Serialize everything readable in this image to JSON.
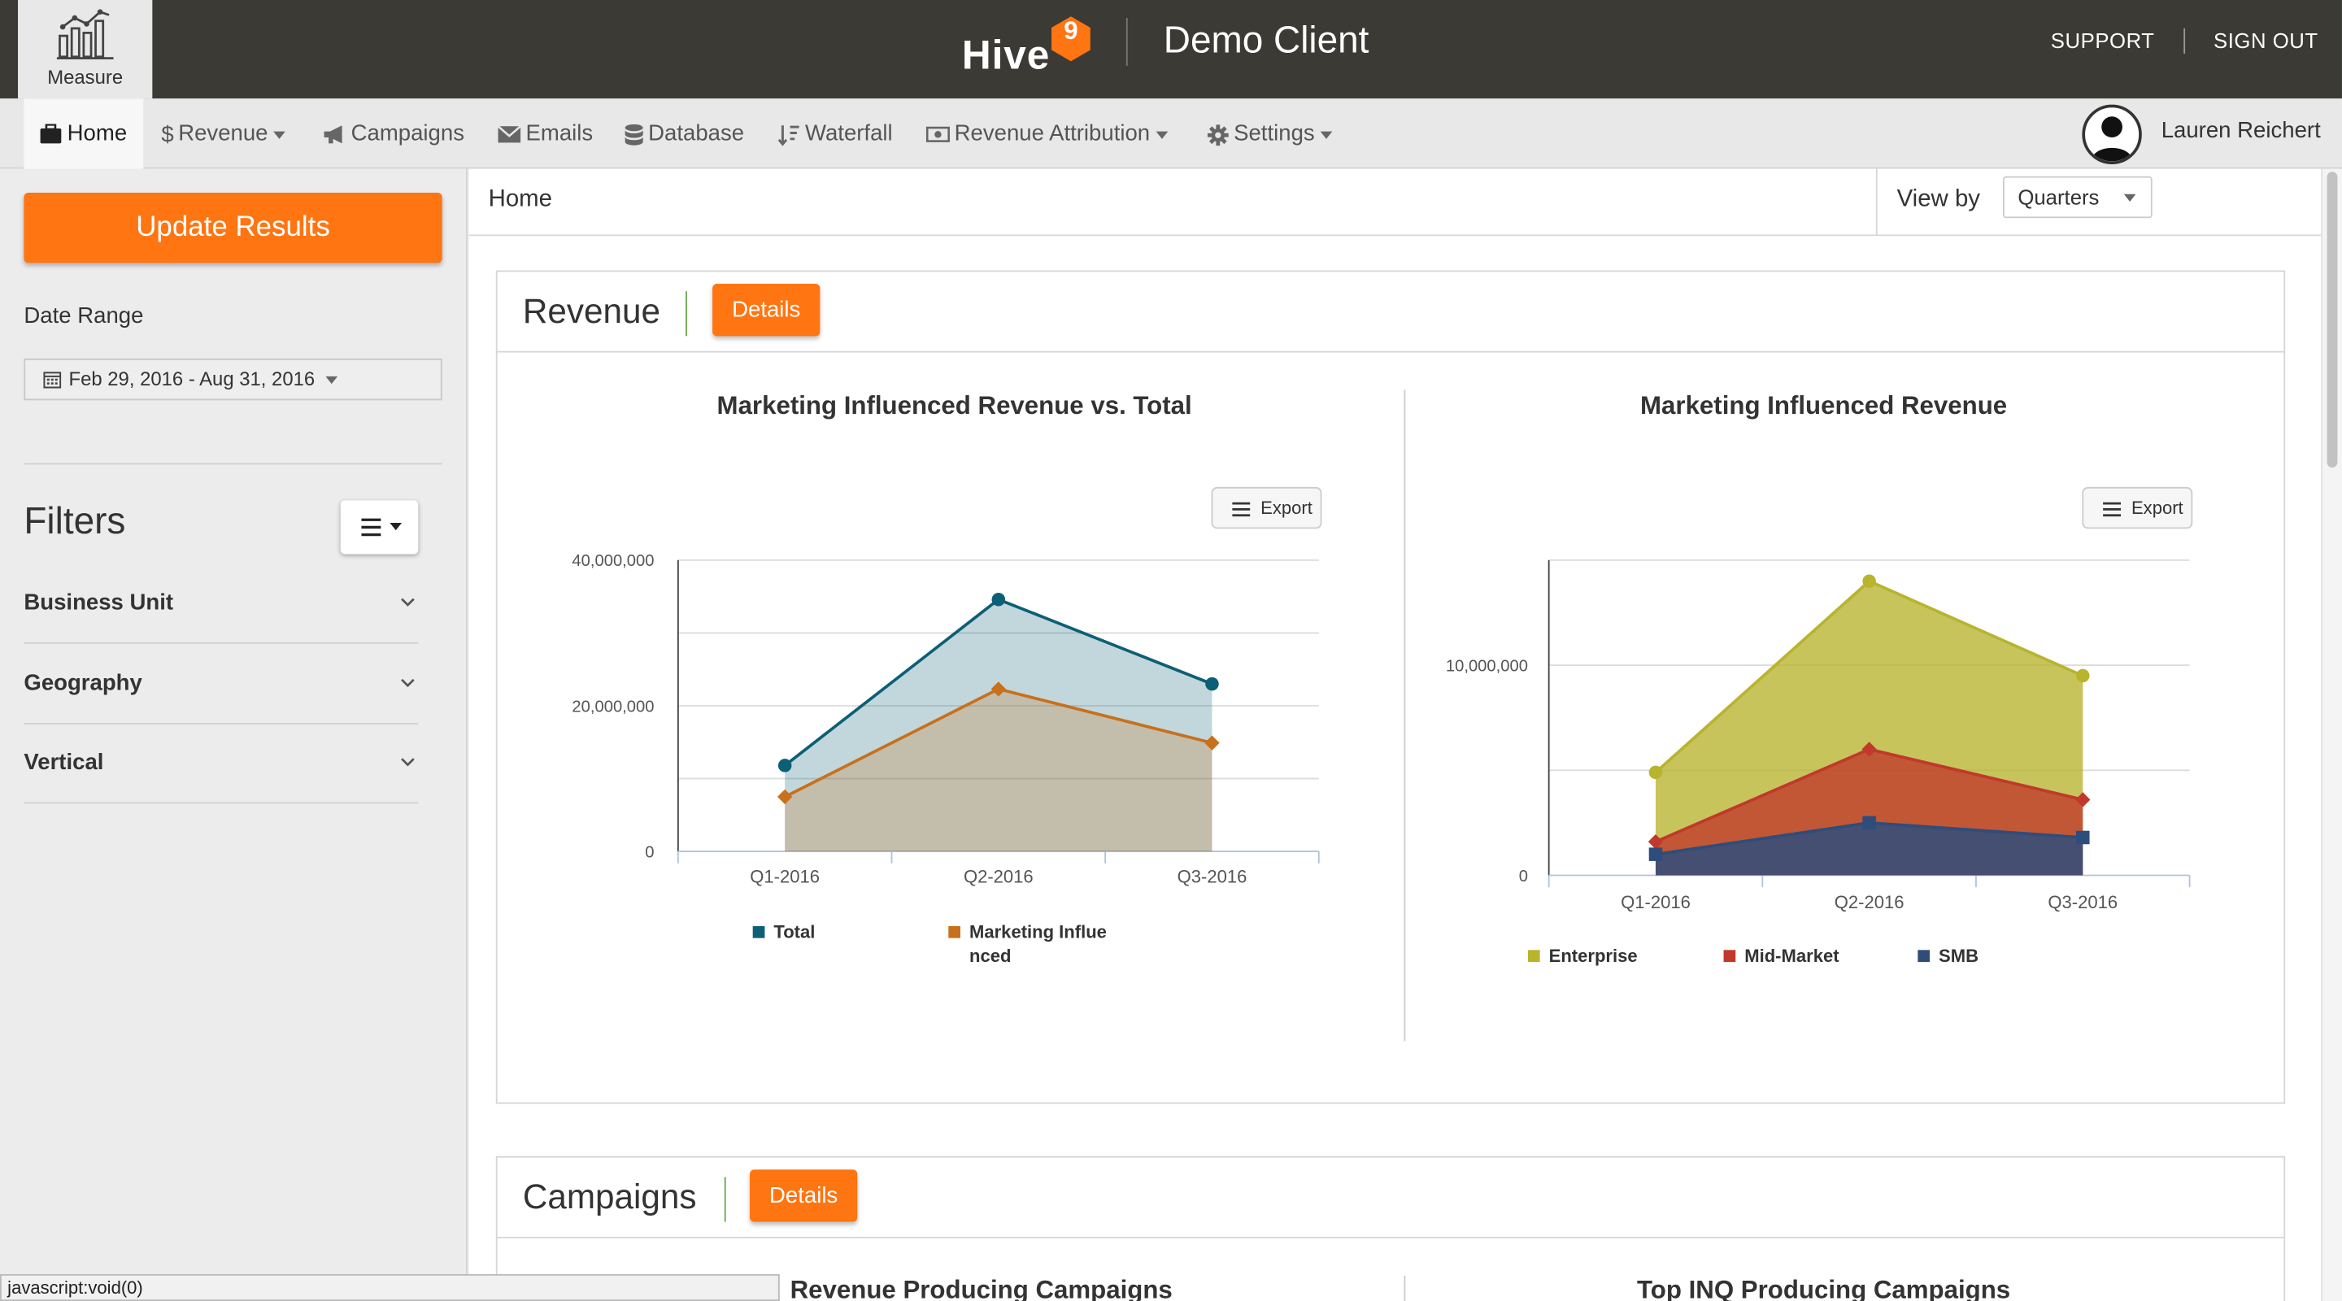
{
  "topbar": {
    "measure_label": "Measure",
    "logo_text": "Hive",
    "logo_badge": "9",
    "client_name": "Demo Client",
    "support": "SUPPORT",
    "signout": "SIGN OUT"
  },
  "nav": {
    "items": [
      {
        "label": "Home",
        "icon": "briefcase-icon"
      },
      {
        "label": "Revenue",
        "icon": "dollar-icon"
      },
      {
        "label": "Campaigns",
        "icon": "bullhorn-icon"
      },
      {
        "label": "Emails",
        "icon": "envelope-icon"
      },
      {
        "label": "Database",
        "icon": "database-icon"
      },
      {
        "label": "Waterfall",
        "icon": "sort-icon"
      },
      {
        "label": "Revenue Attribution",
        "icon": "money-icon"
      },
      {
        "label": "Settings",
        "icon": "gear-icon"
      }
    ],
    "user_name": "Lauren Reichert"
  },
  "sidebar": {
    "update_button": "Update Results",
    "date_range_label": "Date Range",
    "date_range_value": "Feb 29, 2016 - Aug 31, 2016",
    "filters_title": "Filters",
    "filters": [
      "Business Unit",
      "Geography",
      "Vertical"
    ]
  },
  "main": {
    "breadcrumb": "Home",
    "view_by_label": "View by",
    "view_by_value": "Quarters",
    "revenue_panel": {
      "title": "Revenue",
      "details": "Details"
    },
    "campaigns_panel": {
      "title": "Campaigns",
      "details": "Details",
      "chart_titles": [
        "Revenue Producing Campaigns",
        "Top INQ Producing Campaigns"
      ]
    },
    "export_label": "Export"
  },
  "colors": {
    "accent_orange": "#ff7512",
    "total_series": "#0d5f75",
    "marketing_series": "#c8701b",
    "enterprise": "#b8b42e",
    "midmarket": "#c0392b",
    "smb": "#2e4d7b"
  },
  "chart_data": [
    {
      "type": "area",
      "title": "Marketing Influenced Revenue vs. Total",
      "categories": [
        "Q1-2016",
        "Q2-2016",
        "Q3-2016"
      ],
      "ylim": [
        0,
        40000000
      ],
      "yticks": [
        0,
        20000000,
        40000000
      ],
      "ytick_labels": [
        "0",
        "20,000,000",
        "40,000,000"
      ],
      "series": [
        {
          "name": "Total",
          "values": [
            11800000,
            34600000,
            23000000
          ]
        },
        {
          "name": "Marketing Influenced",
          "values": [
            7500000,
            22300000,
            14900000
          ]
        }
      ],
      "grid": true,
      "legend": "bottom"
    },
    {
      "type": "area",
      "title": "Marketing Influenced Revenue",
      "categories": [
        "Q1-2016",
        "Q2-2016",
        "Q3-2016"
      ],
      "ylim": [
        0,
        15000000
      ],
      "yticks": [
        0,
        10000000
      ],
      "ytick_labels": [
        "0",
        "10,000,000"
      ],
      "series": [
        {
          "name": "Enterprise",
          "values": [
            4900000,
            14000000,
            9500000
          ]
        },
        {
          "name": "Mid-Market",
          "values": [
            1600000,
            6000000,
            3600000
          ]
        },
        {
          "name": "SMB",
          "values": [
            1000000,
            2500000,
            1800000
          ]
        }
      ],
      "grid": true,
      "legend": "bottom"
    }
  ],
  "status_bar": "javascript:void(0)"
}
